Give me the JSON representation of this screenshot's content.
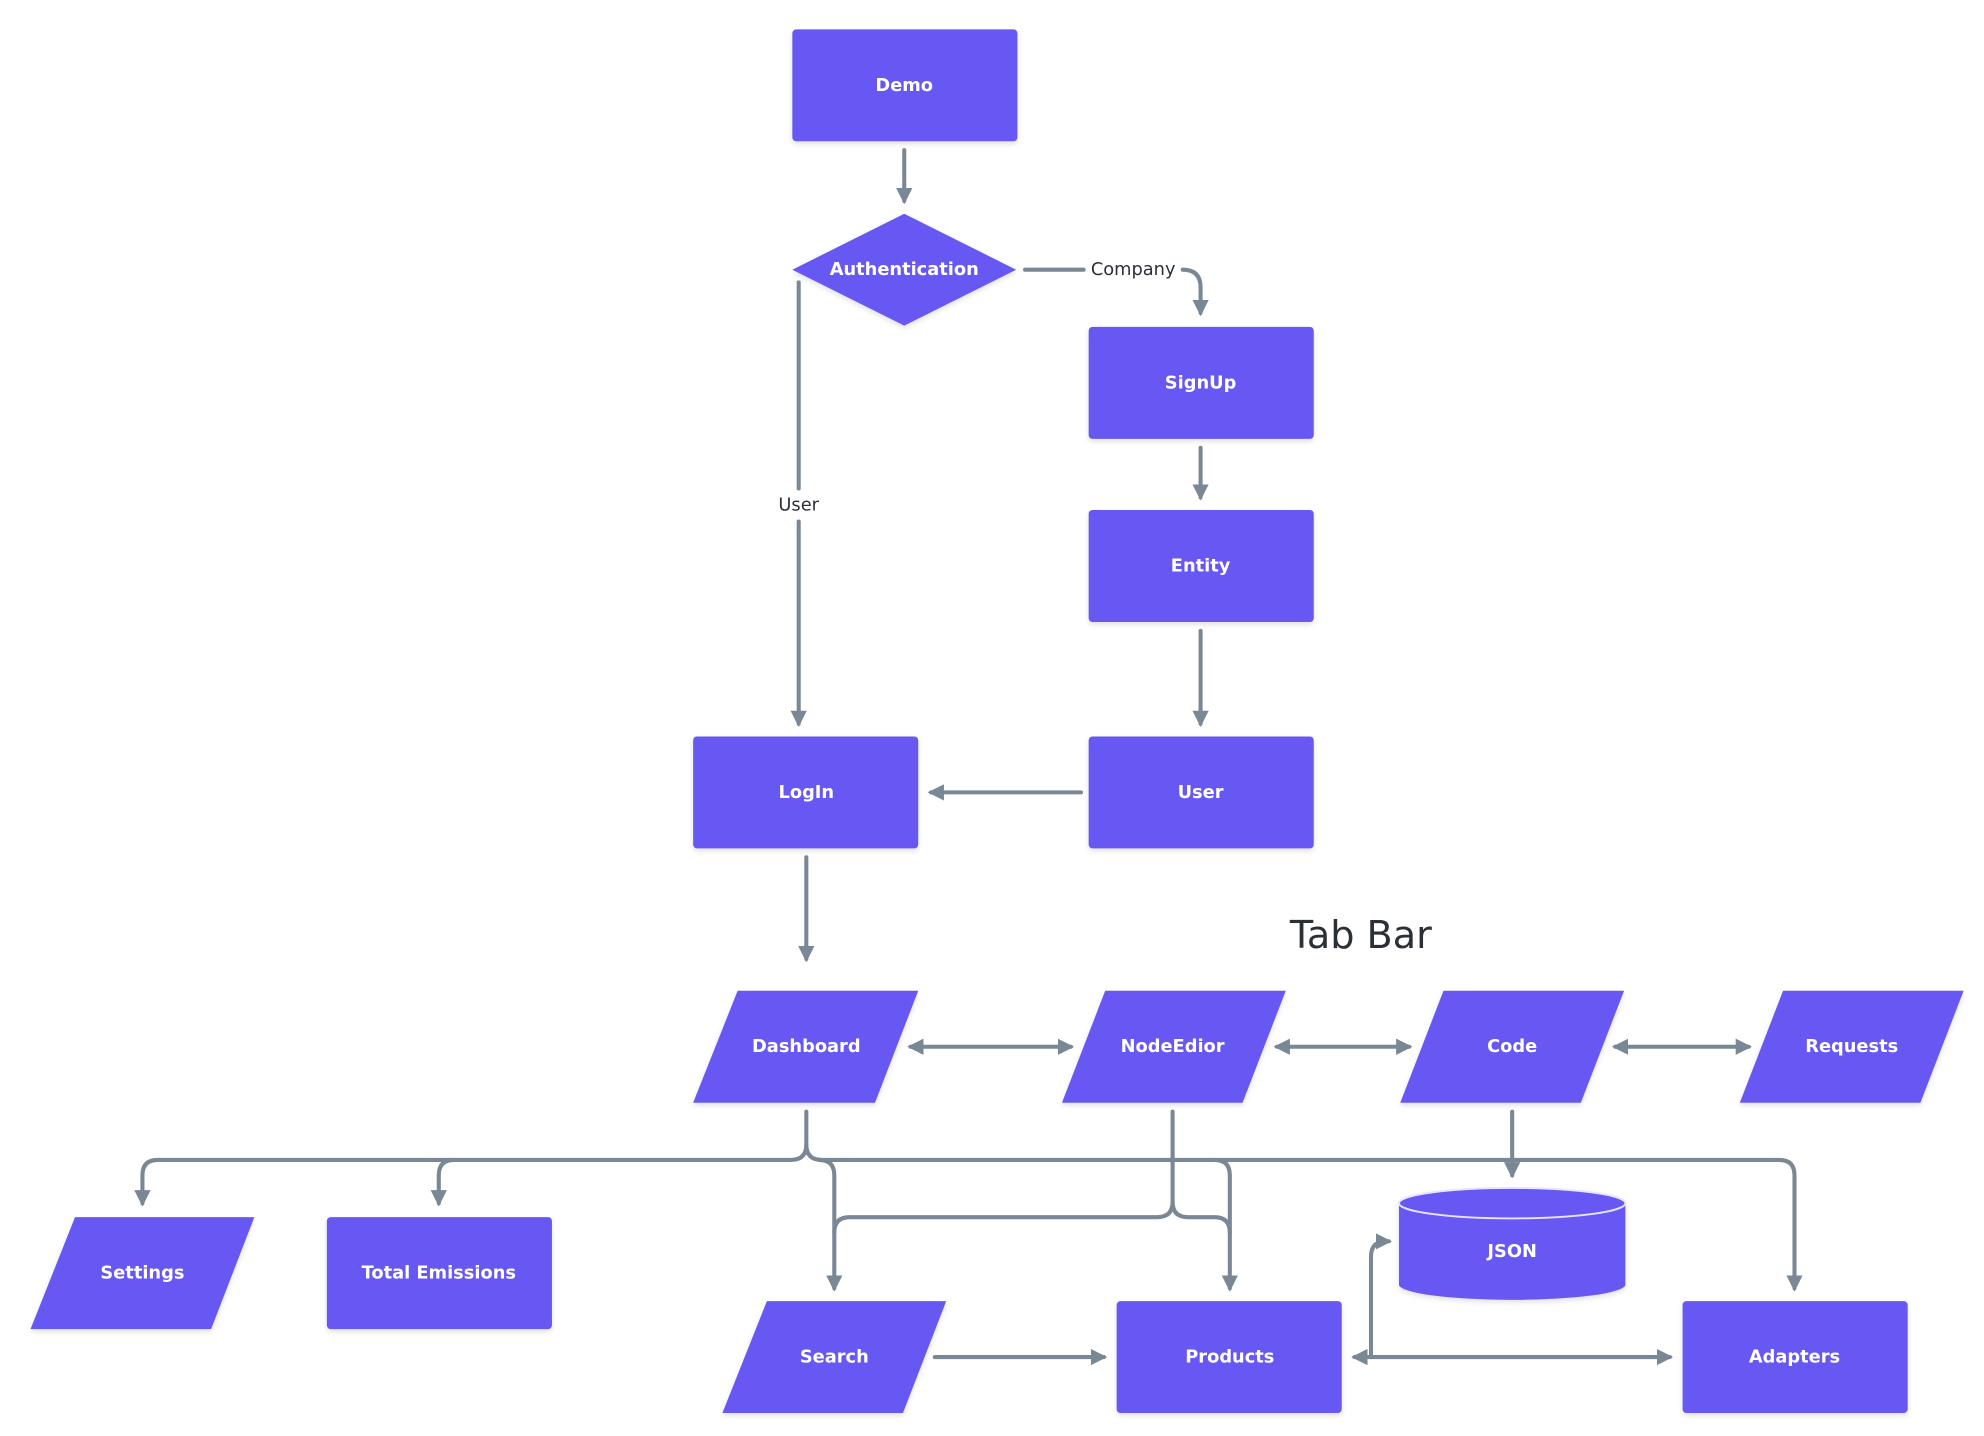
{
  "colors": {
    "node": "#6859F3",
    "edge": "#7A8794",
    "text_on_node": "#FFFFFF",
    "label_text": "#2B2F36"
  },
  "title": "Tab Bar",
  "nodes": {
    "demo": "Demo",
    "authentication": "Authentication",
    "signup": "SignUp",
    "entity": "Entity",
    "user": "User",
    "login": "LogIn",
    "dashboard": "Dashboard",
    "nodeeditor": "NodeEdior",
    "code": "Code",
    "requests": "Requests",
    "settings": "Settings",
    "total_emissions": "Total Emissions",
    "search": "Search",
    "products": "Products",
    "json": "JSON",
    "adapters": "Adapters"
  },
  "edge_labels": {
    "company": "Company",
    "user": "User"
  }
}
